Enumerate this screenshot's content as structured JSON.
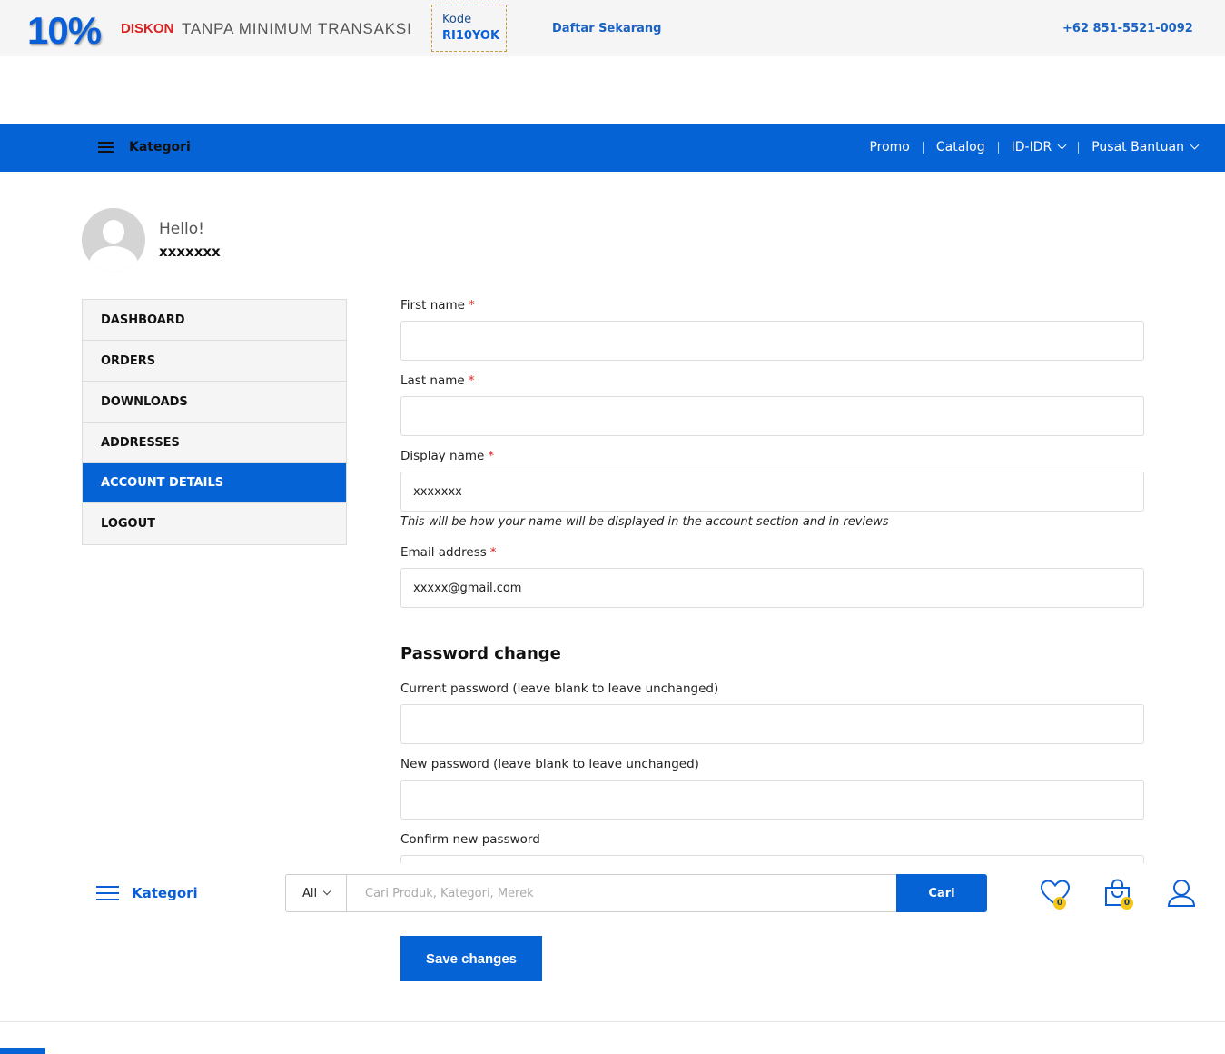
{
  "promo": {
    "percent": "10%",
    "diskon": "DISKON",
    "text": "TANPA MINIMUM TRANSAKSI",
    "code_label": "Kode",
    "code_value": "RI10YOK",
    "register_link": "Daftar Sekarang",
    "phone": "+62 851-5521-0092"
  },
  "nav": {
    "kategori": "Kategori",
    "items": [
      "Promo",
      "Catalog",
      "ID-IDR",
      "Pusat Bantuan"
    ]
  },
  "profile": {
    "greeting": "Hello!",
    "username": "xxxxxxx"
  },
  "sidemenu": {
    "items": [
      "DASHBOARD",
      "ORDERS",
      "DOWNLOADS",
      "ADDRESSES",
      "ACCOUNT DETAILS",
      "LOGOUT"
    ],
    "active": "ACCOUNT DETAILS"
  },
  "form": {
    "first_name_label": "First name",
    "first_name_value": "",
    "last_name_label": "Last name",
    "last_name_value": "",
    "display_name_label": "Display name",
    "display_name_value": "xxxxxxx",
    "display_name_hint": "This will be how your name will be displayed in the account section and in reviews",
    "email_label": "Email address",
    "email_value": "xxxxx@gmail.com",
    "required_mark": "*",
    "password_section": "Password change",
    "current_password_label": "Current password (leave blank to leave unchanged)",
    "new_password_label": "New password (leave blank to leave unchanged)",
    "confirm_password_label": "Confirm new password",
    "save_button": "Save changes"
  },
  "stickybar": {
    "kategori": "Kategori",
    "select_value": "All",
    "search_placeholder": "Cari Produk, Kategori, Merek",
    "search_button": "Cari",
    "wishlist_count": "0",
    "cart_count": "0"
  },
  "colors": {
    "primary": "#0663d6",
    "required": "#e02020",
    "badge": "#f5c518"
  }
}
